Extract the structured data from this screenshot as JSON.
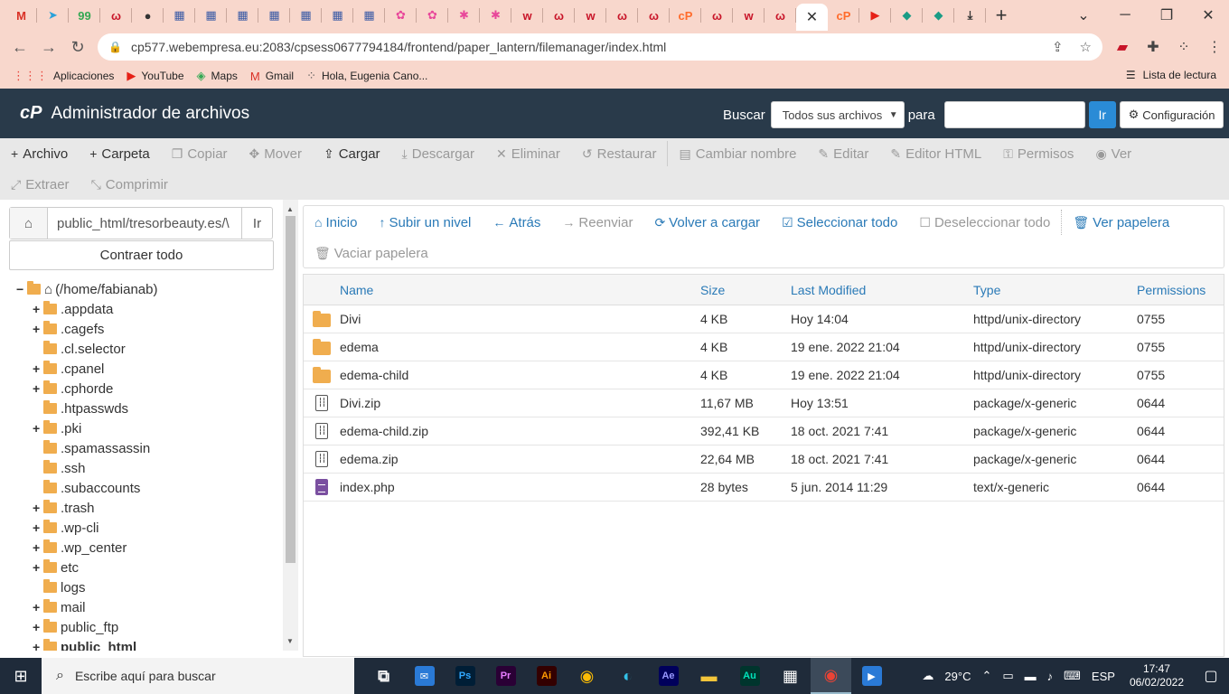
{
  "browser": {
    "tabs": [
      {
        "icon": "gmail-icon",
        "glyph": "M",
        "color": "#d93025"
      },
      {
        "icon": "telegram-icon",
        "glyph": "➤",
        "color": "#2aa1da"
      },
      {
        "icon": "app-99-icon",
        "glyph": "99",
        "color": "#34a853"
      },
      {
        "icon": "webempresa-icon",
        "glyph": "ω",
        "color": "#c81428"
      },
      {
        "icon": "profile-icon",
        "glyph": "●",
        "color": "#333"
      },
      {
        "icon": "calendar-icon",
        "glyph": "▦",
        "color": "#3b5ba5"
      },
      {
        "icon": "calendar-icon",
        "glyph": "▦",
        "color": "#3b5ba5"
      },
      {
        "icon": "calendar-icon",
        "glyph": "▦",
        "color": "#3b5ba5"
      },
      {
        "icon": "calendar-icon",
        "glyph": "▦",
        "color": "#3b5ba5"
      },
      {
        "icon": "calendar-icon",
        "glyph": "▦",
        "color": "#3b5ba5"
      },
      {
        "icon": "calendar-icon",
        "glyph": "▦",
        "color": "#3b5ba5"
      },
      {
        "icon": "calendar-icon",
        "glyph": "▦",
        "color": "#3b5ba5"
      },
      {
        "icon": "flower-icon",
        "glyph": "✿",
        "color": "#e8479a"
      },
      {
        "icon": "flower-icon",
        "glyph": "✿",
        "color": "#e8479a"
      },
      {
        "icon": "asterisk-icon",
        "glyph": "✱",
        "color": "#e8479a"
      },
      {
        "icon": "asterisk-icon",
        "glyph": "✱",
        "color": "#e8479a"
      },
      {
        "icon": "w-icon",
        "glyph": "w",
        "color": "#c81428"
      },
      {
        "icon": "webempresa-icon",
        "glyph": "ω",
        "color": "#c81428"
      },
      {
        "icon": "w-icon",
        "glyph": "w",
        "color": "#c81428"
      },
      {
        "icon": "webempresa-icon",
        "glyph": "ω",
        "color": "#c81428"
      },
      {
        "icon": "webempresa-icon",
        "glyph": "ω",
        "color": "#c81428"
      },
      {
        "icon": "cpanel-icon",
        "glyph": "cP",
        "color": "#ff6c2c"
      },
      {
        "icon": "webempresa-icon",
        "glyph": "ω",
        "color": "#c81428"
      },
      {
        "icon": "w-icon",
        "glyph": "w",
        "color": "#c81428"
      },
      {
        "icon": "webempresa-icon",
        "glyph": "ω",
        "color": "#c81428"
      }
    ],
    "after_active_tabs": [
      {
        "icon": "cpanel-icon",
        "glyph": "cP",
        "color": "#ff6c2c"
      },
      {
        "icon": "youtube-icon",
        "glyph": "▶",
        "color": "#e62117"
      },
      {
        "icon": "diamond-icon",
        "glyph": "◆",
        "color": "#1b9c85"
      },
      {
        "icon": "diamond-icon",
        "glyph": "◆",
        "color": "#1b9c85"
      },
      {
        "icon": "download-icon",
        "glyph": "⤓",
        "color": "#333"
      }
    ],
    "url": "cp577.webempresa.eu:2083/cpsess0677794184/frontend/paper_lantern/filemanager/index.html",
    "bookmarks": [
      {
        "icon": "apps-grid-icon",
        "glyph": "⋮⋮⋮",
        "label": "Aplicaciones",
        "color": "#e8453c"
      },
      {
        "icon": "youtube-icon",
        "glyph": "▶",
        "label": "YouTube",
        "color": "#e62117"
      },
      {
        "icon": "maps-icon",
        "glyph": "◈",
        "label": "Maps",
        "color": "#34a853"
      },
      {
        "icon": "gmail-icon",
        "glyph": "M",
        "label": "Gmail",
        "color": "#d93025"
      },
      {
        "icon": "loading-icon",
        "glyph": "⁘",
        "label": "Hola, Eugenia Cano...",
        "color": "#555"
      }
    ],
    "reading_list": "Lista de lectura"
  },
  "cpanel": {
    "logo": "cP",
    "title": "Administrador de archivos",
    "search_label": "Buscar",
    "search_select": "Todos sus archivos",
    "para_label": "para",
    "go_button": "Ir",
    "config_button": "Configuración"
  },
  "toolbar": {
    "row1": [
      {
        "name": "archivo",
        "label": "Archivo",
        "icon": "+",
        "enabled": true
      },
      {
        "name": "carpeta",
        "label": "Carpeta",
        "icon": "+",
        "enabled": true
      },
      {
        "name": "copiar",
        "label": "Copiar",
        "icon": "❐",
        "enabled": false
      },
      {
        "name": "mover",
        "label": "Mover",
        "icon": "✥",
        "enabled": false
      },
      {
        "name": "cargar",
        "label": "Cargar",
        "icon": "⇪",
        "enabled": true
      },
      {
        "name": "descargar",
        "label": "Descargar",
        "icon": "⤓",
        "enabled": false
      },
      {
        "name": "eliminar",
        "label": "Eliminar",
        "icon": "✕",
        "enabled": false
      },
      {
        "name": "restaurar",
        "label": "Restaurar",
        "icon": "↺",
        "enabled": false
      },
      {
        "name": "cambiar-nombre",
        "label": "Cambiar nombre",
        "icon": "▤",
        "enabled": false
      },
      {
        "name": "editar",
        "label": "Editar",
        "icon": "✎",
        "enabled": false
      },
      {
        "name": "editor-html",
        "label": "Editor HTML",
        "icon": "✎",
        "enabled": false
      },
      {
        "name": "permisos",
        "label": "Permisos",
        "icon": "⚿",
        "enabled": false
      },
      {
        "name": "ver",
        "label": "Ver",
        "icon": "◉",
        "enabled": false
      }
    ],
    "row2": [
      {
        "name": "extraer",
        "label": "Extraer",
        "icon": "⤢",
        "enabled": false
      },
      {
        "name": "comprimir",
        "label": "Comprimir",
        "icon": "⤡",
        "enabled": false
      }
    ]
  },
  "left": {
    "path_value": "public_html/tresorbeauty.es/\\",
    "go": "Ir",
    "collapse_all": "Contraer todo",
    "root_label": "(/home/fabianab)",
    "tree": [
      {
        "label": ".appdata",
        "expandable": true
      },
      {
        "label": ".cagefs",
        "expandable": true
      },
      {
        "label": ".cl.selector",
        "expandable": false
      },
      {
        "label": ".cpanel",
        "expandable": true
      },
      {
        "label": ".cphorde",
        "expandable": true
      },
      {
        "label": ".htpasswds",
        "expandable": false
      },
      {
        "label": ".pki",
        "expandable": true
      },
      {
        "label": ".spamassassin",
        "expandable": false
      },
      {
        "label": ".ssh",
        "expandable": false
      },
      {
        "label": ".subaccounts",
        "expandable": false
      },
      {
        "label": ".trash",
        "expandable": true
      },
      {
        "label": ".wp-cli",
        "expandable": true
      },
      {
        "label": ".wp_center",
        "expandable": true
      },
      {
        "label": "etc",
        "expandable": true
      },
      {
        "label": "logs",
        "expandable": false
      },
      {
        "label": "mail",
        "expandable": true
      },
      {
        "label": "public_ftp",
        "expandable": true
      },
      {
        "label": "public_html",
        "expandable": true,
        "bold": true
      }
    ]
  },
  "actions": {
    "row1": [
      {
        "name": "inicio",
        "label": "Inicio",
        "icon": "⌂",
        "enabled": true
      },
      {
        "name": "subir-nivel",
        "label": "Subir un nivel",
        "icon": "↑",
        "enabled": true
      },
      {
        "name": "atras",
        "label": "Atrás",
        "icon": "←",
        "enabled": true
      },
      {
        "name": "reenviar",
        "label": "Reenviar",
        "icon": "→",
        "enabled": false
      },
      {
        "name": "volver-cargar",
        "label": "Volver a cargar",
        "icon": "⟳",
        "enabled": true
      },
      {
        "name": "seleccionar-todo",
        "label": "Seleccionar todo",
        "icon": "☑",
        "enabled": true
      },
      {
        "name": "deseleccionar-todo",
        "label": "Deseleccionar todo",
        "icon": "☐",
        "enabled": false
      },
      {
        "name": "ver-papelera",
        "label": "Ver papelera",
        "icon": "🗑",
        "enabled": true
      }
    ],
    "row2": [
      {
        "name": "vaciar-papelera",
        "label": "Vaciar papelera",
        "icon": "🗑",
        "enabled": false
      }
    ]
  },
  "files": {
    "headers": {
      "name": "Name",
      "size": "Size",
      "modified": "Last Modified",
      "type": "Type",
      "perms": "Permissions"
    },
    "rows": [
      {
        "kind": "folder",
        "name": "Divi",
        "size": "4 KB",
        "modified": "Hoy 14:04",
        "type": "httpd/unix-directory",
        "perms": "0755"
      },
      {
        "kind": "folder",
        "name": "edema",
        "size": "4 KB",
        "modified": "19 ene. 2022 21:04",
        "type": "httpd/unix-directory",
        "perms": "0755"
      },
      {
        "kind": "folder",
        "name": "edema-child",
        "size": "4 KB",
        "modified": "19 ene. 2022 21:04",
        "type": "httpd/unix-directory",
        "perms": "0755"
      },
      {
        "kind": "zip",
        "name": "Divi.zip",
        "size": "11,67 MB",
        "modified": "Hoy 13:51",
        "type": "package/x-generic",
        "perms": "0644"
      },
      {
        "kind": "zip",
        "name": "edema-child.zip",
        "size": "392,41 KB",
        "modified": "18 oct. 2021 7:41",
        "type": "package/x-generic",
        "perms": "0644"
      },
      {
        "kind": "zip",
        "name": "edema.zip",
        "size": "22,64 MB",
        "modified": "18 oct. 2021 7:41",
        "type": "package/x-generic",
        "perms": "0644"
      },
      {
        "kind": "doc",
        "name": "index.php",
        "size": "28 bytes",
        "modified": "5 jun. 2014 11:29",
        "type": "text/x-generic",
        "perms": "0644"
      }
    ]
  },
  "taskbar": {
    "search_placeholder": "Escribe aquí para buscar",
    "apps": [
      {
        "name": "task-view",
        "glyph": "⧉",
        "bg": "transparent",
        "fg": "#fff"
      },
      {
        "name": "mail",
        "glyph": "✉",
        "bg": "#2a7ad6",
        "fg": "#fff"
      },
      {
        "name": "photoshop",
        "glyph": "Ps",
        "bg": "#001e36",
        "fg": "#31a8ff"
      },
      {
        "name": "premiere",
        "glyph": "Pr",
        "bg": "#2a0035",
        "fg": "#e77cff"
      },
      {
        "name": "illustrator",
        "glyph": "Ai",
        "bg": "#330000",
        "fg": "#ff9a00"
      },
      {
        "name": "chrome",
        "glyph": "◉",
        "bg": "transparent",
        "fg": "#fbbc05"
      },
      {
        "name": "edge",
        "glyph": "◐",
        "bg": "transparent",
        "fg": "#33c1e8"
      },
      {
        "name": "after-effects",
        "glyph": "Ae",
        "bg": "#00005b",
        "fg": "#9999ff"
      },
      {
        "name": "file-explorer",
        "glyph": "▬",
        "bg": "transparent",
        "fg": "#f3c53a"
      },
      {
        "name": "audition",
        "glyph": "Au",
        "bg": "#00352d",
        "fg": "#00e4bb"
      },
      {
        "name": "store",
        "glyph": "▦",
        "bg": "transparent",
        "fg": "#fff"
      },
      {
        "name": "chrome-active",
        "glyph": "◉",
        "bg": "transparent",
        "fg": "#ea4335"
      },
      {
        "name": "media",
        "glyph": "▶",
        "bg": "#2a7ad6",
        "fg": "#fff"
      }
    ],
    "weather": "29°C",
    "lang": "ESP",
    "time": "17:47",
    "date": "06/02/2022"
  }
}
